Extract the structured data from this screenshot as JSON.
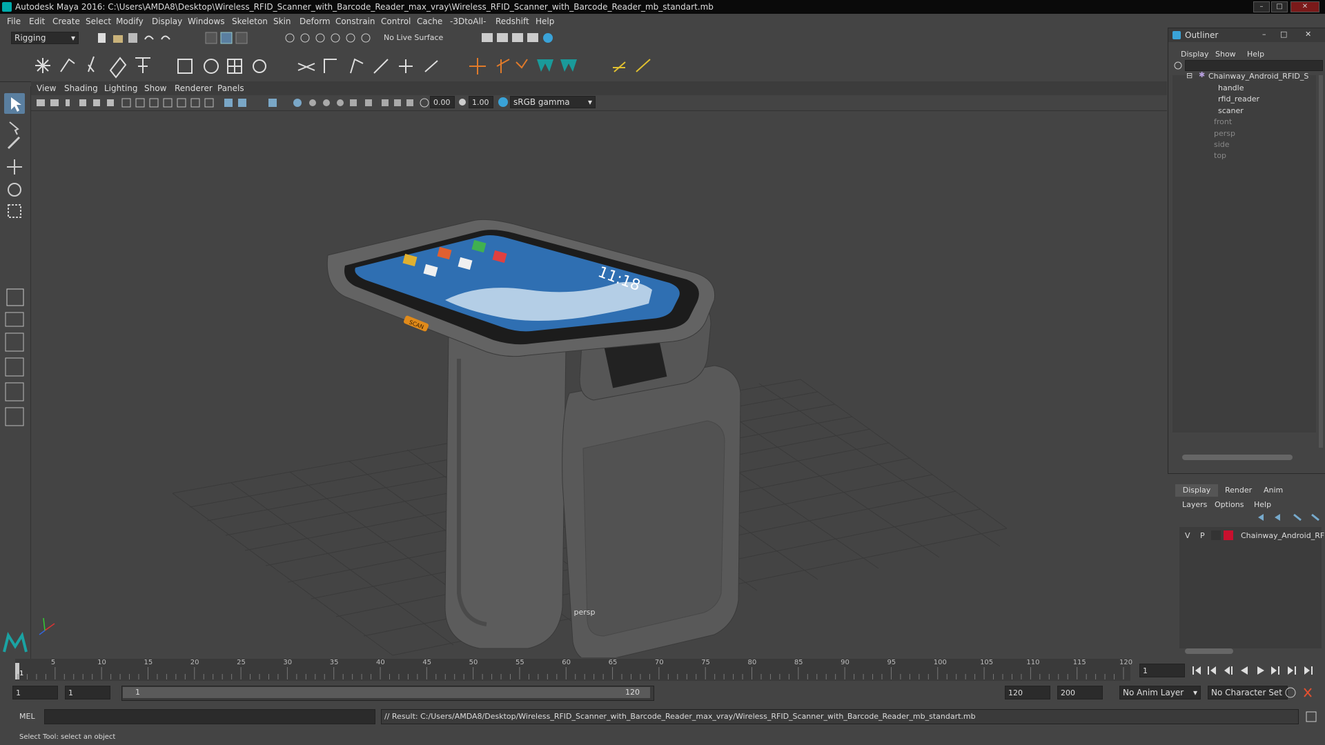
{
  "window": {
    "title": "Autodesk Maya 2016: C:\\Users\\AMDA8\\Desktop\\Wireless_RFID_Scanner_with_Barcode_Reader_max_vray\\Wireless_RFID_Scanner_with_Barcode_Reader_mb_standart.mb"
  },
  "menubar": [
    "File",
    "Edit",
    "Create",
    "Select",
    "Modify",
    "Display",
    "Windows",
    "Skeleton",
    "Skin",
    "Deform",
    "Constrain",
    "Control",
    "Cache",
    "-3DtoAll-",
    "Redshift",
    "Help"
  ],
  "statusline": {
    "menuset": "Rigging",
    "live_surface": "No Live Surface"
  },
  "viewport": {
    "menu": [
      "View",
      "Shading",
      "Lighting",
      "Show",
      "Renderer",
      "Panels"
    ],
    "exposure": "0.00",
    "gamma": "1.00",
    "color_space": "sRGB gamma",
    "camera_label": "persp"
  },
  "outliner": {
    "title": "Outliner",
    "menu": [
      "Display",
      "Show",
      "Help"
    ],
    "root": "Chainway_Android_RFID_S",
    "children": [
      "handle",
      "rfid_reader",
      "scaner"
    ],
    "cameras": [
      "front",
      "persp",
      "side",
      "top"
    ]
  },
  "layer_editor": {
    "tabs": [
      "Display",
      "Render",
      "Anim"
    ],
    "menu": [
      "Layers",
      "Options",
      "Help"
    ],
    "layer": {
      "v": "V",
      "p": "P",
      "name": "Chainway_Android_RF",
      "color": "#c8102e"
    }
  },
  "timeline": {
    "ticks": [
      "5",
      "10",
      "15",
      "20",
      "25",
      "30",
      "35",
      "40",
      "45",
      "50",
      "55",
      "60",
      "65",
      "70",
      "75",
      "80",
      "85",
      "90",
      "95",
      "100",
      "105",
      "110",
      "115",
      "120"
    ],
    "current_frame": "1",
    "current_frame_field": "1"
  },
  "range": {
    "start": "1",
    "playback_start": "1",
    "slider_start": "1",
    "slider_end": "120",
    "playback_end": "120",
    "end": "200",
    "anim_layer": "No Anim Layer",
    "character_set": "No Character Set"
  },
  "cmdline": {
    "label": "MEL",
    "result": "// Result: C:/Users/AMDA8/Desktop/Wireless_RFID_Scanner_with_Barcode_Reader_max_vray/Wireless_RFID_Scanner_with_Barcode_Reader_mb_standart.mb"
  },
  "helpline": "Select Tool: select an object",
  "device_screen": {
    "time": "11:18",
    "scan_button": "SCAN"
  }
}
